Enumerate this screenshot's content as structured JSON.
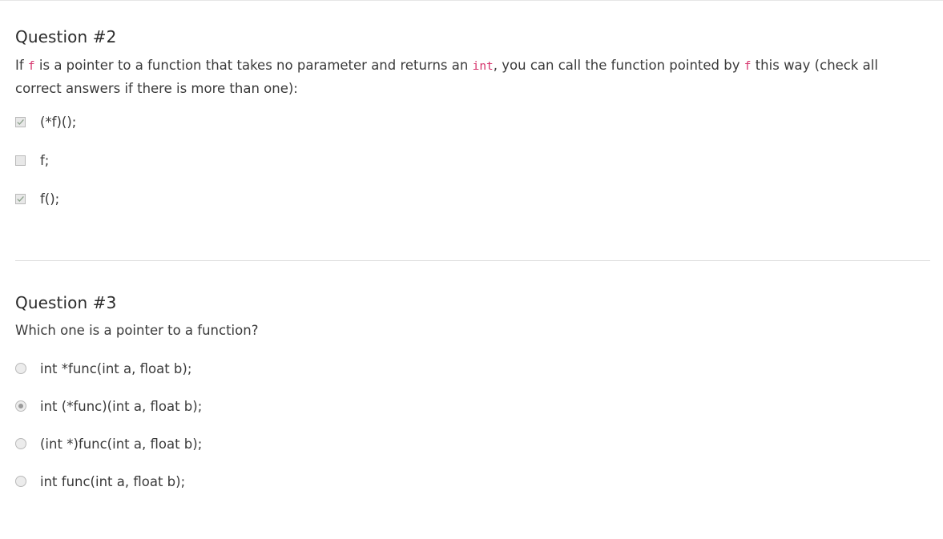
{
  "questions": [
    {
      "title": "Question #2",
      "prompt": {
        "part1": "If ",
        "code1": "f",
        "part2": " is a pointer to a function that takes no parameter and returns an ",
        "code2": "int",
        "part3": ", you can call the function pointed by ",
        "code3": "f",
        "part4": " this way (check all correct answers if there is more than one):"
      },
      "input_type": "checkbox",
      "options": [
        {
          "label": "(*f)();",
          "checked": true
        },
        {
          "label": "f;",
          "checked": false
        },
        {
          "label": "f();",
          "checked": true
        }
      ]
    },
    {
      "title": "Question #3",
      "prompt": "Which one is a pointer to a function?",
      "input_type": "radio",
      "options": [
        {
          "label": "int *func(int a, float b);",
          "checked": false
        },
        {
          "label": "int (*func)(int a, float b);",
          "checked": true
        },
        {
          "label": "(int *)func(int a, float b);",
          "checked": false
        },
        {
          "label": "int func(int a, float b);",
          "checked": false
        }
      ]
    }
  ],
  "colors": {
    "code": "#d6336c",
    "text": "#3a3a3a",
    "divider": "#dcdcdc",
    "control_check": "#8aa08a"
  }
}
